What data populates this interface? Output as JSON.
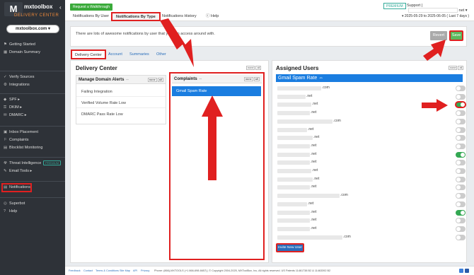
{
  "brand": {
    "logo_letter": "M",
    "name": "mxtoolbox",
    "sub": "DELIVERY CENTER"
  },
  "account": {
    "label": "mxtoolbox.com ▾"
  },
  "sidebar": {
    "groups": [
      [
        {
          "label": "Getting Started",
          "icon": "rocket-icon",
          "glyph": "⚑"
        },
        {
          "label": "Domain Summary",
          "icon": "grid-icon",
          "glyph": "▦"
        }
      ],
      [
        {
          "label": "Verify Sources",
          "icon": "shield-check-icon",
          "glyph": "✓"
        },
        {
          "label": "Integrations",
          "icon": "plug-icon",
          "glyph": "⚙"
        }
      ],
      [
        {
          "label": "SPF ▸",
          "icon": "shield-icon",
          "glyph": "◆"
        },
        {
          "label": "DKIM ▸",
          "icon": "key-icon",
          "glyph": "⚿"
        },
        {
          "label": "DMARC ▸",
          "icon": "envelope-icon",
          "glyph": "✉"
        }
      ],
      [
        {
          "label": "Inbox Placement",
          "icon": "inbox-icon",
          "glyph": "▣"
        },
        {
          "label": "Complaints",
          "icon": "flag-icon",
          "glyph": "⚐"
        },
        {
          "label": "Blocklist Monitoring",
          "icon": "blocklist-icon",
          "glyph": "▤"
        }
      ],
      [
        {
          "label": "Threat Intelligence",
          "icon": "threat-icon",
          "glyph": "☢",
          "badge": "PREMIUM"
        },
        {
          "label": "Email Tools ▸",
          "icon": "tools-icon",
          "glyph": "✎"
        }
      ],
      [
        {
          "label": "Notifications",
          "icon": "notification-icon",
          "glyph": "▤"
        }
      ],
      [
        {
          "label": "Superbot",
          "icon": "robot-icon",
          "glyph": "◎"
        },
        {
          "label": "Help",
          "icon": "help-icon",
          "glyph": "?"
        }
      ]
    ]
  },
  "topbar": {
    "walkthrough": "Request a Walkthrough",
    "tabs": [
      "Notifications By User",
      "Notifications By Type",
      "Notifications History",
      "Help"
    ],
    "premium": "PREMIUM",
    "support": "Support |",
    "user_suffix": "net ▾",
    "date_range": "▾ 2025-05-29 to 2025-06-05 ( Last 7 days )"
  },
  "info": {
    "text": "There are lots of awesome notifications by user that you can access around with.",
    "reset": "Revert",
    "save": "Save"
  },
  "subtabs": [
    "Delivery Center",
    "Account",
    "Summaries",
    "Other"
  ],
  "delivery_center": {
    "title": "Delivery Center",
    "none": "none",
    "all": "all",
    "manage": {
      "title": "Manage Domain Alerts",
      "items": [
        "Failing Integration",
        "Verified Volume Rate Low",
        "DMARC Pass Rate Low"
      ]
    },
    "complaints": {
      "title": "Complaints",
      "items": [
        "Gmail Spam Rate"
      ]
    }
  },
  "assigned": {
    "title": "Assigned Users",
    "selected": "Gmail Spam Rate",
    "users": [
      {
        "suffix": ".com",
        "on": false
      },
      {
        "suffix": ".net",
        "on": false
      },
      {
        "suffix": ".net",
        "on": true
      },
      {
        "suffix": ".net",
        "on": false
      },
      {
        "suffix": ".com",
        "on": false
      },
      {
        "suffix": ".net",
        "on": false
      },
      {
        "suffix": ".net",
        "on": false
      },
      {
        "suffix": ".net",
        "on": false
      },
      {
        "suffix": ".net",
        "on": true
      },
      {
        "suffix": ".net",
        "on": false
      },
      {
        "suffix": ".net",
        "on": false
      },
      {
        "suffix": ".net",
        "on": false
      },
      {
        "suffix": ".net",
        "on": false
      },
      {
        "suffix": ".com",
        "on": false
      },
      {
        "suffix": ".net",
        "on": false
      },
      {
        "suffix": ".net",
        "on": true
      },
      {
        "suffix": ".net",
        "on": false
      },
      {
        "suffix": ".net",
        "on": false
      },
      {
        "suffix": ".com",
        "on": false
      }
    ],
    "invite": "Invite New User"
  },
  "footer": {
    "links": [
      "Feedback",
      "Contact",
      "Terms & Conditions",
      "Site Map",
      "API",
      "Privacy"
    ],
    "text": "Phone: (866)-MXTOOLS (+1 866-698-6657) | © Copyright 2004-2025, MXToolBox, Inc, All rights reserved. US Patents 11461738 B2 & 11463392 B2"
  },
  "colors": {
    "accent": "#1a7de0",
    "save": "#5cb85c",
    "toggle_on": "#34a853",
    "annotation": "#e02020",
    "sidebar": "#2e3238"
  }
}
